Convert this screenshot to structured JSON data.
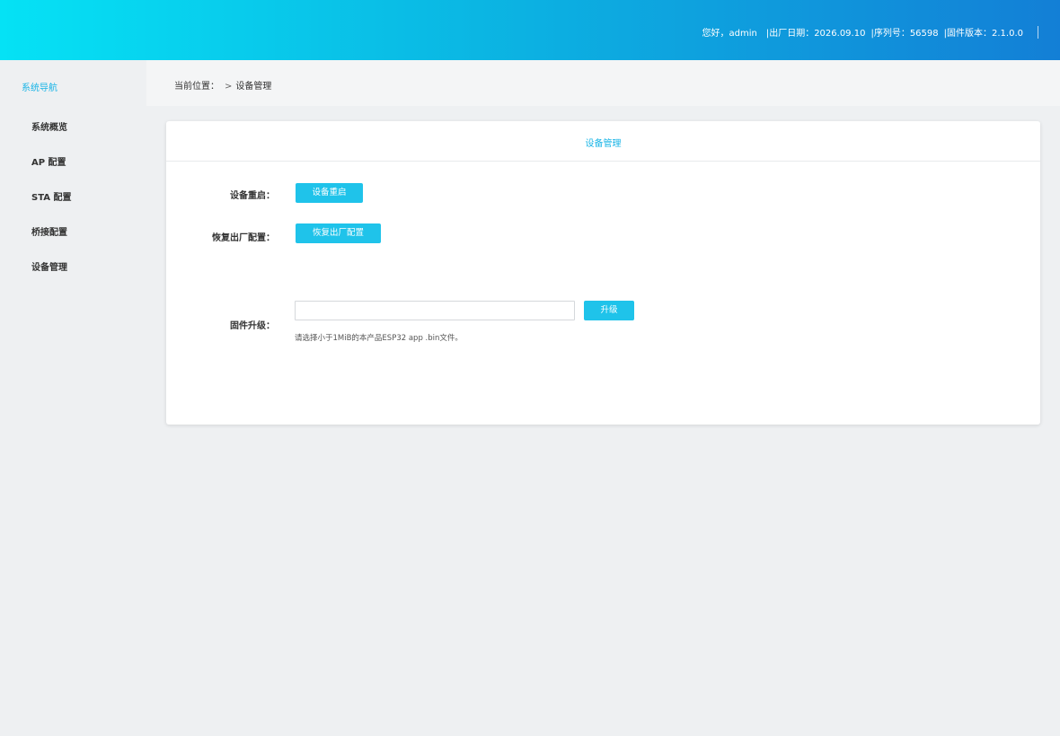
{
  "header": {
    "greeting": "您好，admin",
    "production_date": "|出厂日期：2026.09.10",
    "serial_number": "|序列号：56598",
    "firmware_version": "|固件版本：2.1.0.0",
    "gradient_colors": [
      "#05e2f5",
      "#137fd6"
    ]
  },
  "sidebar": {
    "title": "系统导航",
    "items": [
      {
        "label": "系统概览"
      },
      {
        "label": "AP 配置"
      },
      {
        "label": "STA 配置"
      },
      {
        "label": "桥接配置"
      },
      {
        "label": "设备管理"
      }
    ]
  },
  "breadcrumb": {
    "prefix": "当前位置：",
    "chevron": ">",
    "current": "设备管理"
  },
  "card": {
    "title": "设备管理",
    "reboot": {
      "label": "设备重启：",
      "button": "设备重启"
    },
    "factory_reset": {
      "label": "恢复出厂配置：",
      "button": "恢复出厂配置"
    },
    "firmware": {
      "label": "固件升级：",
      "file_value": "",
      "button": "升级",
      "hint": "请选择小于1MiB的本产品ESP32 app .bin文件。"
    }
  },
  "colors": {
    "accent": "#18b4e6",
    "button": "#1fc3ea",
    "page_bg": "#eef0f2"
  }
}
